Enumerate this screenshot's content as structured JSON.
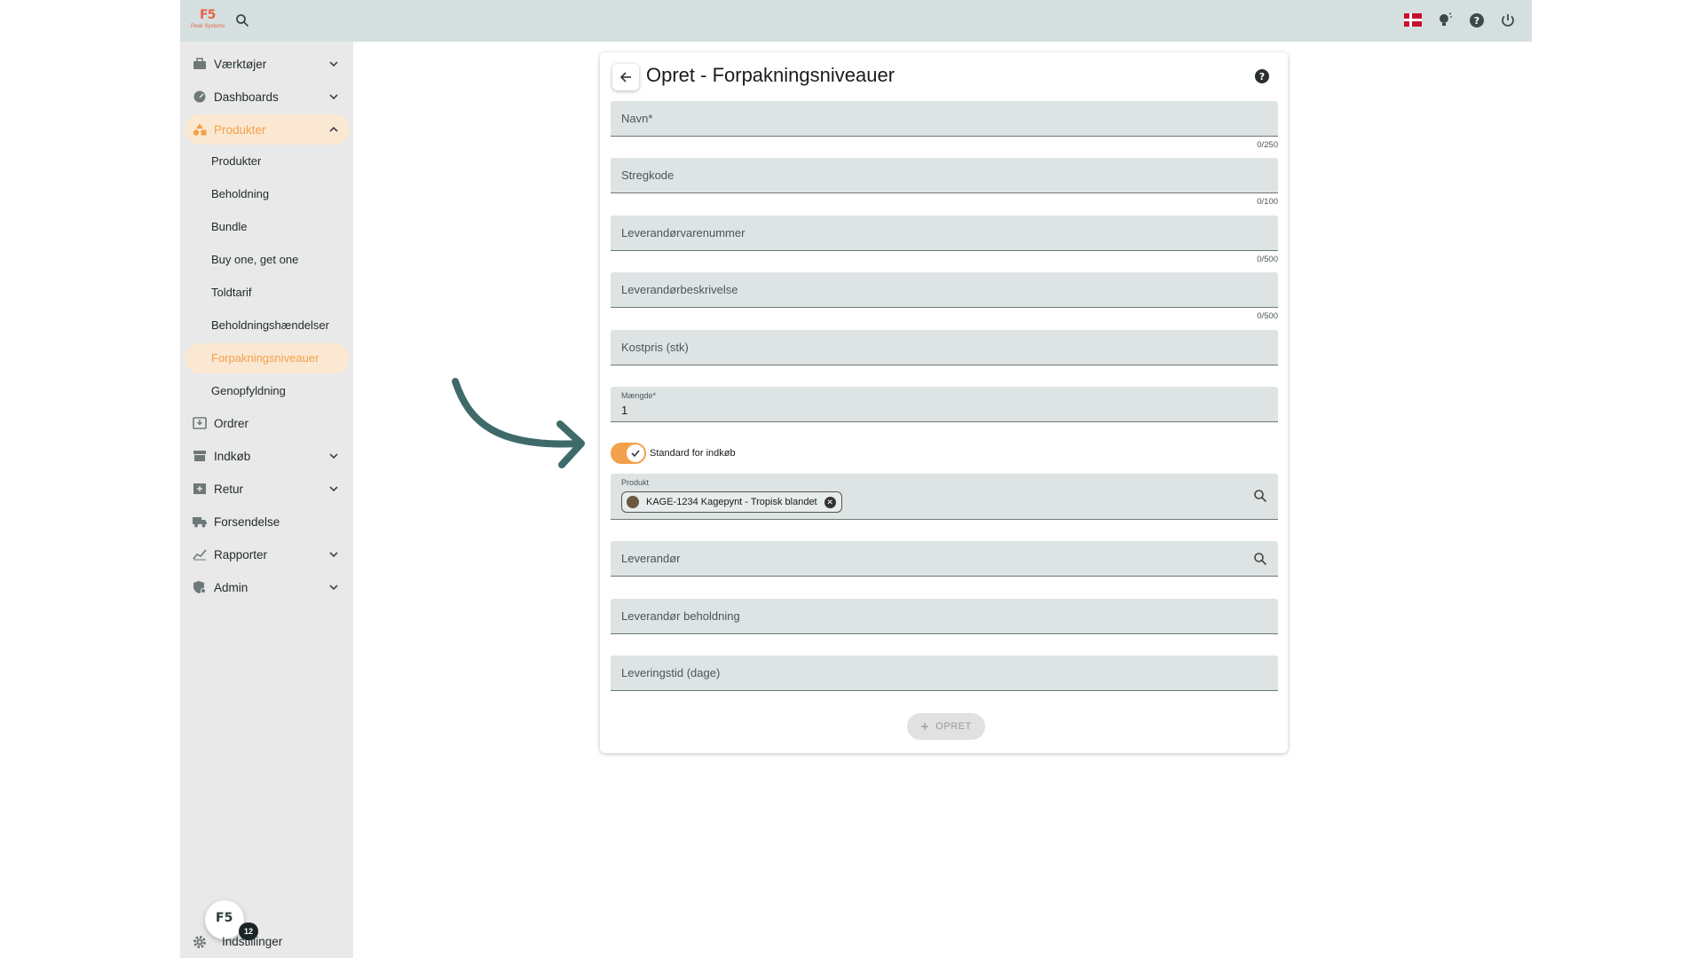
{
  "topbar": {
    "logo_mark": "F5",
    "logo_text": "Peak Systems",
    "icons": [
      "search-icon",
      "danish-flag-icon",
      "lightbulb-icon",
      "help-icon",
      "power-icon"
    ]
  },
  "sidebar": {
    "items": [
      {
        "label": "Værktøjer",
        "icon": "toolbox-icon",
        "expandable": true
      },
      {
        "label": "Dashboards",
        "icon": "gauge-icon",
        "expandable": true
      },
      {
        "label": "Produkter",
        "icon": "shapes-icon",
        "expandable": true,
        "expanded": true,
        "active": true
      },
      {
        "label": "Ordrer",
        "icon": "inbox-icon",
        "expandable": false
      },
      {
        "label": "Indkøb",
        "icon": "store-icon",
        "expandable": true
      },
      {
        "label": "Retur",
        "icon": "return-box-icon",
        "expandable": true
      },
      {
        "label": "Forsendelse",
        "icon": "truck-icon",
        "expandable": false
      },
      {
        "label": "Rapporter",
        "icon": "chart-icon",
        "expandable": true
      },
      {
        "label": "Admin",
        "icon": "admin-shield-icon",
        "expandable": true
      }
    ],
    "sub_items": [
      "Produkter",
      "Beholdning",
      "Bundle",
      "Buy one, get one",
      "Toldtarif",
      "Beholdningshændelser",
      "Forpakningsniveauer",
      "Genopfyldning"
    ],
    "active_sub_item": "Forpakningsniveauer",
    "fab_mark": "F5",
    "badge_count": "12",
    "settings_label": "Indstillinger"
  },
  "form": {
    "title": "Opret - Forpakningsniveauer",
    "fields": {
      "navn": {
        "label": "Navn*",
        "counter": "0/250"
      },
      "stregkode": {
        "label": "Stregkode",
        "counter": "0/100"
      },
      "leverandorvarenummer": {
        "label": "Leverandørvarenummer",
        "counter": "0/500"
      },
      "leverandorbeskrivelse": {
        "label": "Leverandørbeskrivelse",
        "counter": "0/500"
      },
      "kostpris": {
        "label": "Kostpris (stk)"
      },
      "maengde": {
        "label": "Mængde*",
        "value": "1"
      },
      "produkt": {
        "label": "Produkt",
        "chip": "KAGE-1234 Kagepynt - Tropisk blandet"
      },
      "leverandor": {
        "label": "Leverandør"
      },
      "leverandor_beholdning": {
        "label": "Leverandør beholdning"
      },
      "leveringstid": {
        "label": "Leveringstid (dage)"
      }
    },
    "toggle": {
      "label": "Standard for indkøb",
      "checked": true
    },
    "submit_label": "OPRET"
  },
  "colors": {
    "accent": "#f3a04a",
    "topbar": "#d6dfdf",
    "sidebar": "#e9e9e9",
    "field": "#dee4e4",
    "arrow": "#3e6a6a"
  }
}
